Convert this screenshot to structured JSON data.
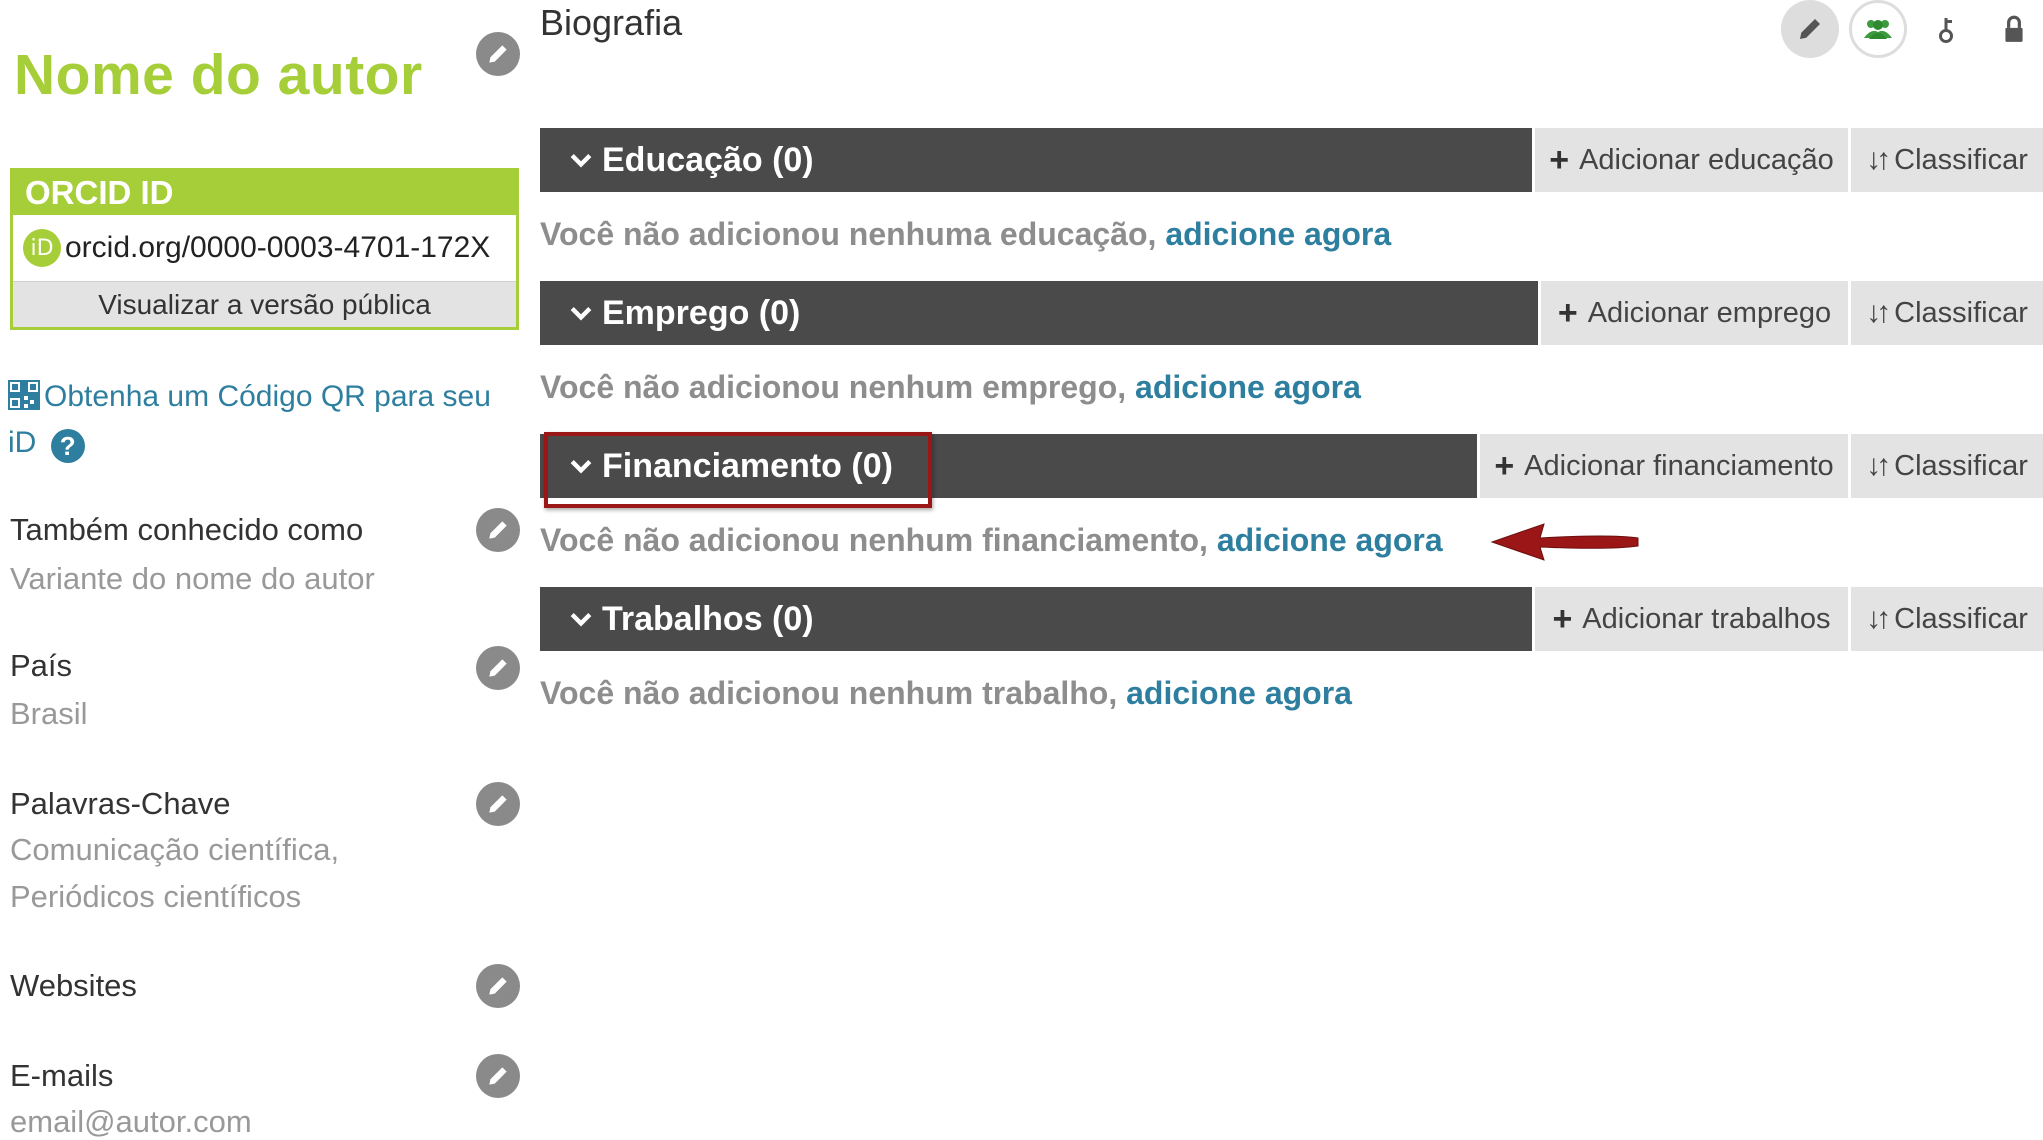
{
  "left": {
    "author_name": "Nome do autor",
    "orcid": {
      "header": "ORCID ID",
      "badge": "iD",
      "id": "orcid.org/0000-0003-4701-172X",
      "public_link": "Visualizar a versão pública"
    },
    "qr": {
      "text_1": "Obtenha um Código QR para seu",
      "text_2": "iD",
      "help": "?"
    },
    "fields": [
      {
        "label": "Também conhecido como",
        "value": "Variante do nome do autor"
      },
      {
        "label": "País",
        "value": "Brasil"
      },
      {
        "label": "Palavras-Chave",
        "value_lines": [
          "Comunicação científica,",
          "Periódicos científicos"
        ]
      },
      {
        "label": "Websites"
      },
      {
        "label": "E-mails",
        "value": "email@autor.com"
      }
    ]
  },
  "main": {
    "title": "Biografia",
    "top_icons": [
      "pencil-icon",
      "people-icon",
      "person-icon",
      "lock-icon"
    ],
    "sort_label": "Classificar",
    "sections": [
      {
        "title": "Educação (0)",
        "add_label": "Adicionar educação",
        "msg": "Você não adicionou nenhuma educação,",
        "link": "adicione agora"
      },
      {
        "title": "Emprego (0)",
        "add_label": "Adicionar emprego",
        "msg": "Você não adicionou nenhum emprego,",
        "link": "adicione agora"
      },
      {
        "title": "Financiamento (0)",
        "add_label": "Adicionar financiamento",
        "msg": "Você não adicionou nenhum financiamento,",
        "link": "adicione agora"
      },
      {
        "title": "Trabalhos (0)",
        "add_label": "Adicionar trabalhos",
        "msg": "Você não adicionou nenhum trabalho,",
        "link": "adicione agora"
      }
    ]
  },
  "colors": {
    "orcid_green": "#a6ce39",
    "link_blue": "#2e7f9f",
    "bar_dark": "#4a4a4a",
    "highlight_red": "#9b1717"
  }
}
